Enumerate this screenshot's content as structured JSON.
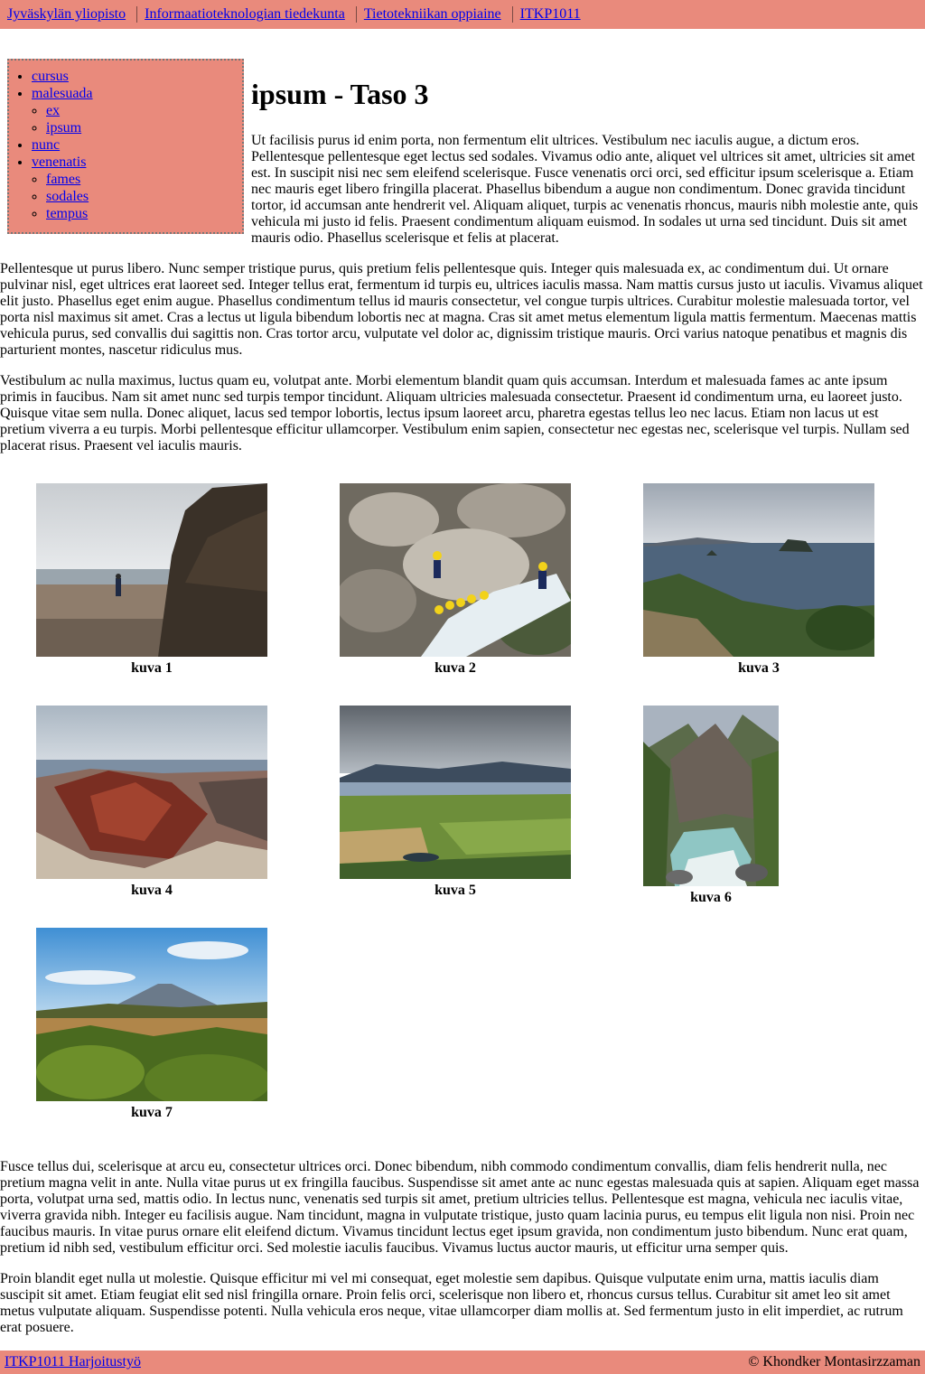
{
  "breadcrumb": [
    {
      "label": "Jyväskylän yliopisto"
    },
    {
      "label": "Informaatioteknologian tiedekunta"
    },
    {
      "label": "Tietotekniikan oppiaine"
    },
    {
      "label": "ITKP1011"
    }
  ],
  "nav": {
    "items": [
      {
        "label": "cursus"
      },
      {
        "label": "malesuada",
        "children": [
          {
            "label": "ex"
          },
          {
            "label": "ipsum"
          }
        ]
      },
      {
        "label": "nunc"
      },
      {
        "label": "venenatis",
        "children": [
          {
            "label": "fames"
          },
          {
            "label": "sodales"
          },
          {
            "label": "tempus"
          }
        ]
      }
    ]
  },
  "page": {
    "title": "ipsum - Taso 3",
    "paragraphs": [
      "Ut facilisis purus id enim porta, non fermentum elit ultrices. Vestibulum nec iaculis augue, a dictum eros. Pellentesque pellentesque eget lectus sed sodales. Vivamus odio ante, aliquet vel ultrices sit amet, ultricies sit amet est. In suscipit nisi nec sem eleifend scelerisque. Fusce venenatis orci orci, sed efficitur ipsum scelerisque a. Etiam nec mauris eget libero fringilla placerat. Phasellus bibendum a augue non condimentum. Donec gravida tincidunt tortor, id accumsan ante hendrerit vel. Aliquam aliquet, turpis ac venenatis rhoncus, mauris nibh molestie ante, quis vehicula mi justo id felis. Praesent condimentum aliquam euismod. In sodales ut urna sed tincidunt. Duis sit amet mauris odio. Phasellus scelerisque et felis at placerat.",
      "Pellentesque ut purus libero. Nunc semper tristique purus, quis pretium felis pellentesque quis. Integer quis malesuada ex, ac condimentum dui. Ut ornare pulvinar nisl, eget ultrices erat laoreet sed. Integer tellus erat, fermentum id turpis eu, ultrices iaculis massa. Nam mattis cursus justo ut iaculis. Vivamus aliquet elit justo. Phasellus eget enim augue. Phasellus condimentum tellus id mauris consectetur, vel congue turpis ultrices. Curabitur molestie malesuada tortor, vel porta nisl maximus sit amet. Cras a lectus ut ligula bibendum lobortis nec at magna. Cras sit amet metus elementum ligula mattis fermentum. Maecenas mattis vehicula purus, sed convallis dui sagittis non. Cras tortor arcu, vulputate vel dolor ac, dignissim tristique mauris. Orci varius natoque penatibus et magnis dis parturient montes, nascetur ridiculus mus.",
      "Vestibulum ac nulla maximus, luctus quam eu, volutpat ante. Morbi elementum blandit quam quis accumsan. Interdum et malesuada fames ac ante ipsum primis in faucibus. Nam sit amet nunc sed turpis tempor tincidunt. Aliquam ultricies malesuada consectetur. Praesent id condimentum urna, eu laoreet justo. Quisque vitae sem nulla. Donec aliquet, lacus sed tempor lobortis, lectus ipsum laoreet arcu, pharetra egestas tellus leo nec lacus. Etiam non lacus ut est pretium viverra a eu turpis. Morbi pellentesque efficitur ullamcorper. Vestibulum enim sapien, consectetur nec egestas nec, scelerisque vel turpis. Nullam sed placerat risus. Praesent vel iaculis mauris."
    ],
    "after_paragraphs": [
      "Fusce tellus dui, scelerisque at arcu eu, consectetur ultrices orci. Donec bibendum, nibh commodo condimentum convallis, diam felis hendrerit nulla, nec pretium magna velit in ante. Nulla vitae purus ut ex fringilla faucibus. Suspendisse sit amet ante ac nunc egestas malesuada quis at sapien. Aliquam eget massa porta, volutpat urna sed, mattis odio. In lectus nunc, venenatis sed turpis sit amet, pretium ultricies tellus. Pellentesque est magna, vehicula nec iaculis vitae, viverra gravida nibh. Integer eu facilisis augue. Nam tincidunt, magna in vulputate tristique, justo quam lacinia purus, eu tempus elit ligula non nisi. Proin nec faucibus mauris. In vitae purus ornare elit eleifend dictum. Vivamus tincidunt lectus eget ipsum gravida, non condimentum justo bibendum. Nunc erat quam, pretium id nibh sed, vestibulum efficitur orci. Sed molestie iaculis faucibus. Vivamus luctus auctor mauris, ut efficitur urna semper quis.",
      "Proin blandit eget nulla ut molestie. Quisque efficitur mi vel mi consequat, eget molestie sem dapibus. Quisque vulputate enim urna, mattis iaculis diam suscipit sit amet. Etiam feugiat elit sed nisl fringilla ornare. Proin felis orci, scelerisque non libero et, rhoncus cursus tellus. Curabitur sit amet leo sit amet metus vulputate aliquam. Suspendisse potenti. Nulla vehicula eros neque, vitae ullamcorper diam mollis at. Sed fermentum justo in elit imperdiet, ac rutrum erat posuere."
    ]
  },
  "gallery": [
    {
      "caption": "kuva 1",
      "scene": "beach with cliff"
    },
    {
      "caption": "kuva 2",
      "scene": "canyoning group on rocks"
    },
    {
      "caption": "kuva 3",
      "scene": "coastal islands view"
    },
    {
      "caption": "kuva 4",
      "scene": "red volcanic crater"
    },
    {
      "caption": "kuva 5",
      "scene": "lake and green farmland"
    },
    {
      "caption": "kuva 6",
      "scene": "mountain river in forest"
    },
    {
      "caption": "kuva 7",
      "scene": "volcano over shrubland"
    }
  ],
  "footer": {
    "link_label": "ITKP1011 Harjoitustyö",
    "copyright": "©  Khondker Montasirzzaman"
  },
  "colors": {
    "accent_bg": "#e98a7c",
    "link": "#0000ee"
  }
}
